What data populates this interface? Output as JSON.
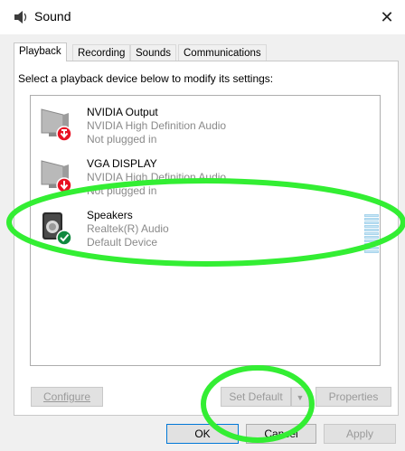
{
  "window": {
    "title": "Sound",
    "close_glyph": "✕"
  },
  "tabs": [
    {
      "label": "Playback",
      "active": true
    },
    {
      "label": "Recording",
      "active": false
    },
    {
      "label": "Sounds",
      "active": false
    },
    {
      "label": "Communications",
      "active": false
    }
  ],
  "instruction": "Select a playback device below to modify its settings:",
  "devices": [
    {
      "name": "NVIDIA Output",
      "driver": "NVIDIA High Definition Audio",
      "status": "Not plugged in",
      "icon": "monitor-icon",
      "badge": "red-down-arrow-icon"
    },
    {
      "name": "VGA DISPLAY",
      "driver": "NVIDIA High Definition Audio",
      "status": "Not plugged in",
      "icon": "monitor-icon",
      "badge": "red-down-arrow-icon"
    },
    {
      "name": "Speakers",
      "driver": "Realtek(R) Audio",
      "status": "Default Device",
      "icon": "speaker-icon",
      "badge": "green-check-icon"
    }
  ],
  "buttons": {
    "configure": "Configure",
    "set_default": "Set Default",
    "properties": "Properties",
    "ok": "OK",
    "cancel": "Cancel",
    "apply": "Apply"
  },
  "colors": {
    "highlight_green": "#33ee33",
    "accent": "#0078d7",
    "red": "#e81123",
    "green": "#10893e"
  }
}
